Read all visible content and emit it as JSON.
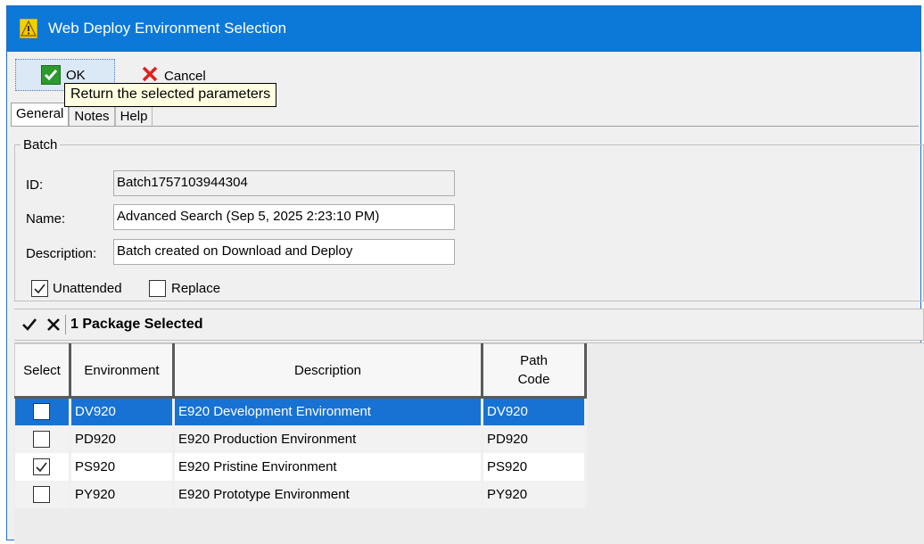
{
  "window": {
    "title": "Web Deploy Environment Selection"
  },
  "toolbar": {
    "ok_label": "OK",
    "cancel_label": "Cancel",
    "tooltip": "Return the selected parameters"
  },
  "tabs": [
    {
      "label": "General",
      "active": true
    },
    {
      "label": "Notes",
      "active": false
    },
    {
      "label": "Help",
      "active": false
    }
  ],
  "batch": {
    "legend": "Batch",
    "id_label": "ID:",
    "id_value": "Batch1757103944304",
    "name_label": "Name:",
    "name_value": "Advanced Search (Sep 5, 2025 2:23:10 PM)",
    "description_label": "Description:",
    "description_value": "Batch created on Download and Deploy",
    "unattended_label": "Unattended",
    "unattended_checked": true,
    "replace_label": "Replace",
    "replace_checked": false
  },
  "grid": {
    "selection_count": "1 Package Selected",
    "columns": [
      "Select",
      "Environment",
      "Description",
      "Path Code"
    ],
    "rows": [
      {
        "environment": "DV920",
        "description": "E920 Development Environment",
        "path_code": "DV920",
        "checked": false,
        "selected": true
      },
      {
        "environment": "PD920",
        "description": "E920 Production Environment",
        "path_code": "PD920",
        "checked": false,
        "selected": false
      },
      {
        "environment": "PS920",
        "description": "E920 Pristine Environment",
        "path_code": "PS920",
        "checked": true,
        "selected": false
      },
      {
        "environment": "PY920",
        "description": "E920 Prototype Environment",
        "path_code": "PY920",
        "checked": false,
        "selected": false
      }
    ]
  },
  "colors": {
    "titlebar": "#0c78d8",
    "selection": "#1872d4",
    "ok_check": "#2c9a2c",
    "cancel_x": "#e02020"
  }
}
